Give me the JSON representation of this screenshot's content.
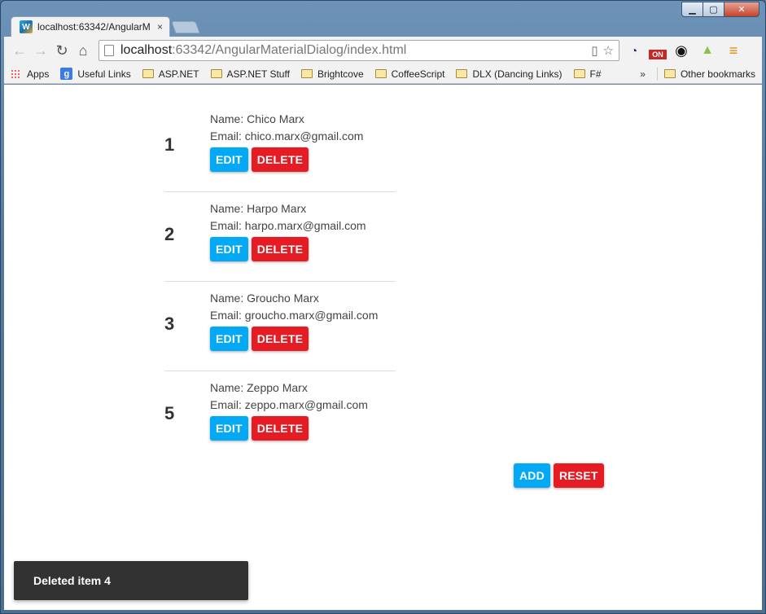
{
  "browser": {
    "tab_title": "localhost:63342/AngularM",
    "tab_close": "×",
    "favicon_letter": "W",
    "url_host": "localhost",
    "url_rest": ":63342/AngularMaterialDialog/index.html",
    "window_controls": {
      "minimize": "▁",
      "maximize": "▢",
      "close": "✕"
    },
    "nav": {
      "back": "←",
      "forward": "→",
      "reload": "↻",
      "home": "⌂"
    },
    "star_icon": "☆",
    "ext_on_label": "ON",
    "bookmarks": [
      {
        "label": "Apps",
        "icon": "apps-grid-icon"
      },
      {
        "label": "Useful Links",
        "icon": "google-icon"
      },
      {
        "label": "ASP.NET",
        "icon": "folder-icon"
      },
      {
        "label": "ASP.NET Stuff",
        "icon": "folder-icon"
      },
      {
        "label": "Brightcove",
        "icon": "folder-icon"
      },
      {
        "label": "CoffeeScript",
        "icon": "folder-icon"
      },
      {
        "label": "DLX (Dancing Links)",
        "icon": "folder-icon"
      },
      {
        "label": "F#",
        "icon": "folder-icon"
      }
    ],
    "bookmarks_more": "»",
    "other_bookmarks": "Other bookmarks"
  },
  "items": [
    {
      "number": "1",
      "name_line": "Name: Chico Marx",
      "email_line": "Email: chico.marx@gmail.com"
    },
    {
      "number": "2",
      "name_line": "Name: Harpo Marx",
      "email_line": "Email: harpo.marx@gmail.com"
    },
    {
      "number": "3",
      "name_line": "Name: Groucho Marx",
      "email_line": "Email: groucho.marx@gmail.com"
    },
    {
      "number": "5",
      "name_line": "Name: Zeppo Marx",
      "email_line": "Email: zeppo.marx@gmail.com"
    }
  ],
  "buttons": {
    "edit": "EDIT",
    "delete": "DELETE",
    "add": "ADD",
    "reset": "RESET"
  },
  "toast": {
    "message": "Deleted item 4"
  },
  "colors": {
    "primary": "#03a9f4",
    "warn": "#e51c23",
    "toast_bg": "#323232"
  }
}
